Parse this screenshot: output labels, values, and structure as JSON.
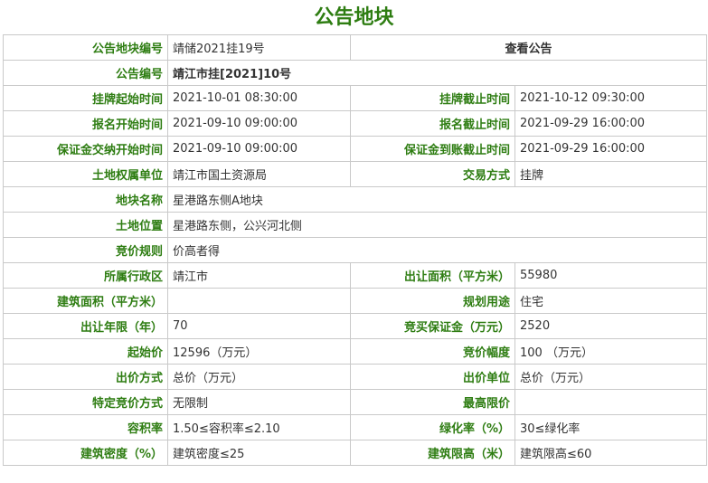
{
  "page": {
    "title": "公告地块"
  },
  "colors": {
    "label": "#2e7d12",
    "border": "#c9c9c9",
    "text": "#333333"
  },
  "rows": {
    "parcel_no": {
      "label": "公告地块编号",
      "value": "靖储2021挂19号",
      "link": "查看公告"
    },
    "notice_no": {
      "label": "公告编号",
      "value": "靖江市挂[2021]10号"
    },
    "listing_start": {
      "label": "挂牌起始时间",
      "value": "2021-10-01 08:30:00"
    },
    "listing_end": {
      "label": "挂牌截止时间",
      "value": "2021-10-12 09:30:00"
    },
    "signup_start": {
      "label": "报名开始时间",
      "value": "2021-09-10 09:00:00"
    },
    "signup_end": {
      "label": "报名截止时间",
      "value": "2021-09-29 16:00:00"
    },
    "deposit_start": {
      "label": "保证金交纳开始时间",
      "value": "2021-09-10 09:00:00"
    },
    "deposit_end": {
      "label": "保证金到账截止时间",
      "value": "2021-09-29 16:00:00"
    },
    "owner": {
      "label": "土地权属单位",
      "value": "靖江市国土资源局"
    },
    "trade_mode": {
      "label": "交易方式",
      "value": "挂牌"
    },
    "parcel_name": {
      "label": "地块名称",
      "value": "星港路东侧A地块"
    },
    "location": {
      "label": "土地位置",
      "value": "星港路东侧，公兴河北侧"
    },
    "bid_rule": {
      "label": "竞价规则",
      "value": "价高者得"
    },
    "district": {
      "label": "所属行政区",
      "value": "靖江市"
    },
    "area": {
      "label": "出让面积（平方米）",
      "value": "55980"
    },
    "floor_area": {
      "label": "建筑面积（平方米）",
      "value": ""
    },
    "usage": {
      "label": "规划用途",
      "value": "住宅"
    },
    "term": {
      "label": "出让年限（年）",
      "value": "70"
    },
    "bid_deposit": {
      "label": "竞买保证金（万元）",
      "value": "2520"
    },
    "start_price": {
      "label": "起始价",
      "value": "12596（万元）"
    },
    "increment": {
      "label": "竞价幅度",
      "value": "100 （万元）"
    },
    "bid_mode": {
      "label": "出价方式",
      "value": "总价（万元）"
    },
    "bid_unit": {
      "label": "出价单位",
      "value": "总价（万元）"
    },
    "special_mode": {
      "label": "特定竞价方式",
      "value": "无限制"
    },
    "max_price": {
      "label": "最高限价",
      "value": ""
    },
    "far": {
      "label": "容积率",
      "value": "1.50≤容积率≤2.10"
    },
    "green": {
      "label": "绿化率（%）",
      "value": "30≤绿化率"
    },
    "density": {
      "label": "建筑密度（%）",
      "value": "建筑密度≤25"
    },
    "height": {
      "label": "建筑限高（米）",
      "value": "建筑限高≤60"
    }
  }
}
